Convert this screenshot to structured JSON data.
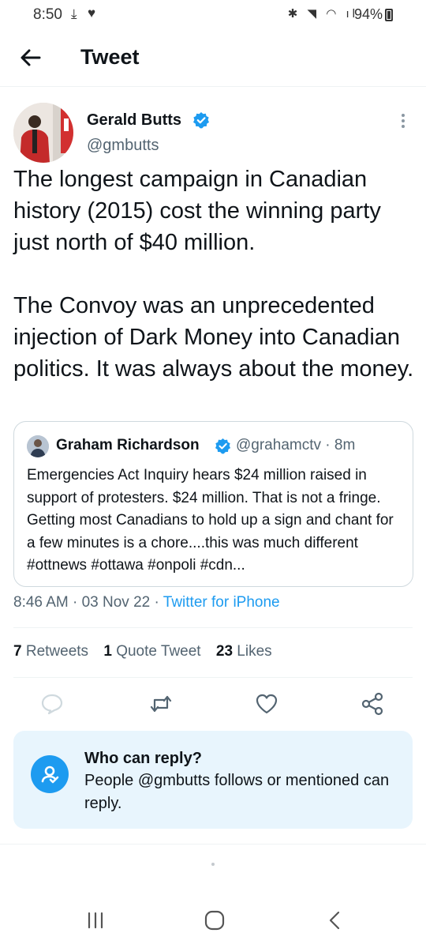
{
  "status_bar": {
    "time": "8:50",
    "battery": "94%"
  },
  "header": {
    "title": "Tweet"
  },
  "tweet": {
    "author_name": "Gerald Butts",
    "author_handle": "@gmbutts",
    "text": "The longest campaign in Canadian history (2015) cost the winning party just north of $40 million.\n\nThe Convoy was an unprecedented injection of Dark Money into Canadian politics. It was always about the money.",
    "time": "8:46 AM",
    "date": "03 Nov 22",
    "source": "Twitter for iPhone"
  },
  "quote": {
    "author_name": "Graham Richardson",
    "author_handle": "@grahamctv",
    "age": "8m",
    "text": "Emergencies Act Inquiry hears $24 million raised in support of protesters. $24 million. That is not a fringe. Getting most Canadians to hold up a sign and chant for a few minutes is a chore....this was much different #ottnews #ottawa #onpoli #cdn..."
  },
  "stats": {
    "retweets_count": "7",
    "retweets_label": "Retweets",
    "quotes_count": "1",
    "quotes_label": "Quote Tweet",
    "likes_count": "23",
    "likes_label": "Likes"
  },
  "reply_settings": {
    "title": "Who can reply?",
    "description": "People @gmbutts follows or mentioned can reply."
  },
  "icons": {
    "back": "arrow-left-icon",
    "verified": "verified-badge-icon",
    "more": "more-vertical-icon",
    "reply": "reply-icon",
    "retweet": "retweet-icon",
    "like": "heart-icon",
    "share": "share-icon"
  },
  "colors": {
    "accent": "#1d9bf0",
    "text": "#0f1419",
    "secondary": "#536471",
    "reply_box_bg": "#e8f5fd"
  }
}
